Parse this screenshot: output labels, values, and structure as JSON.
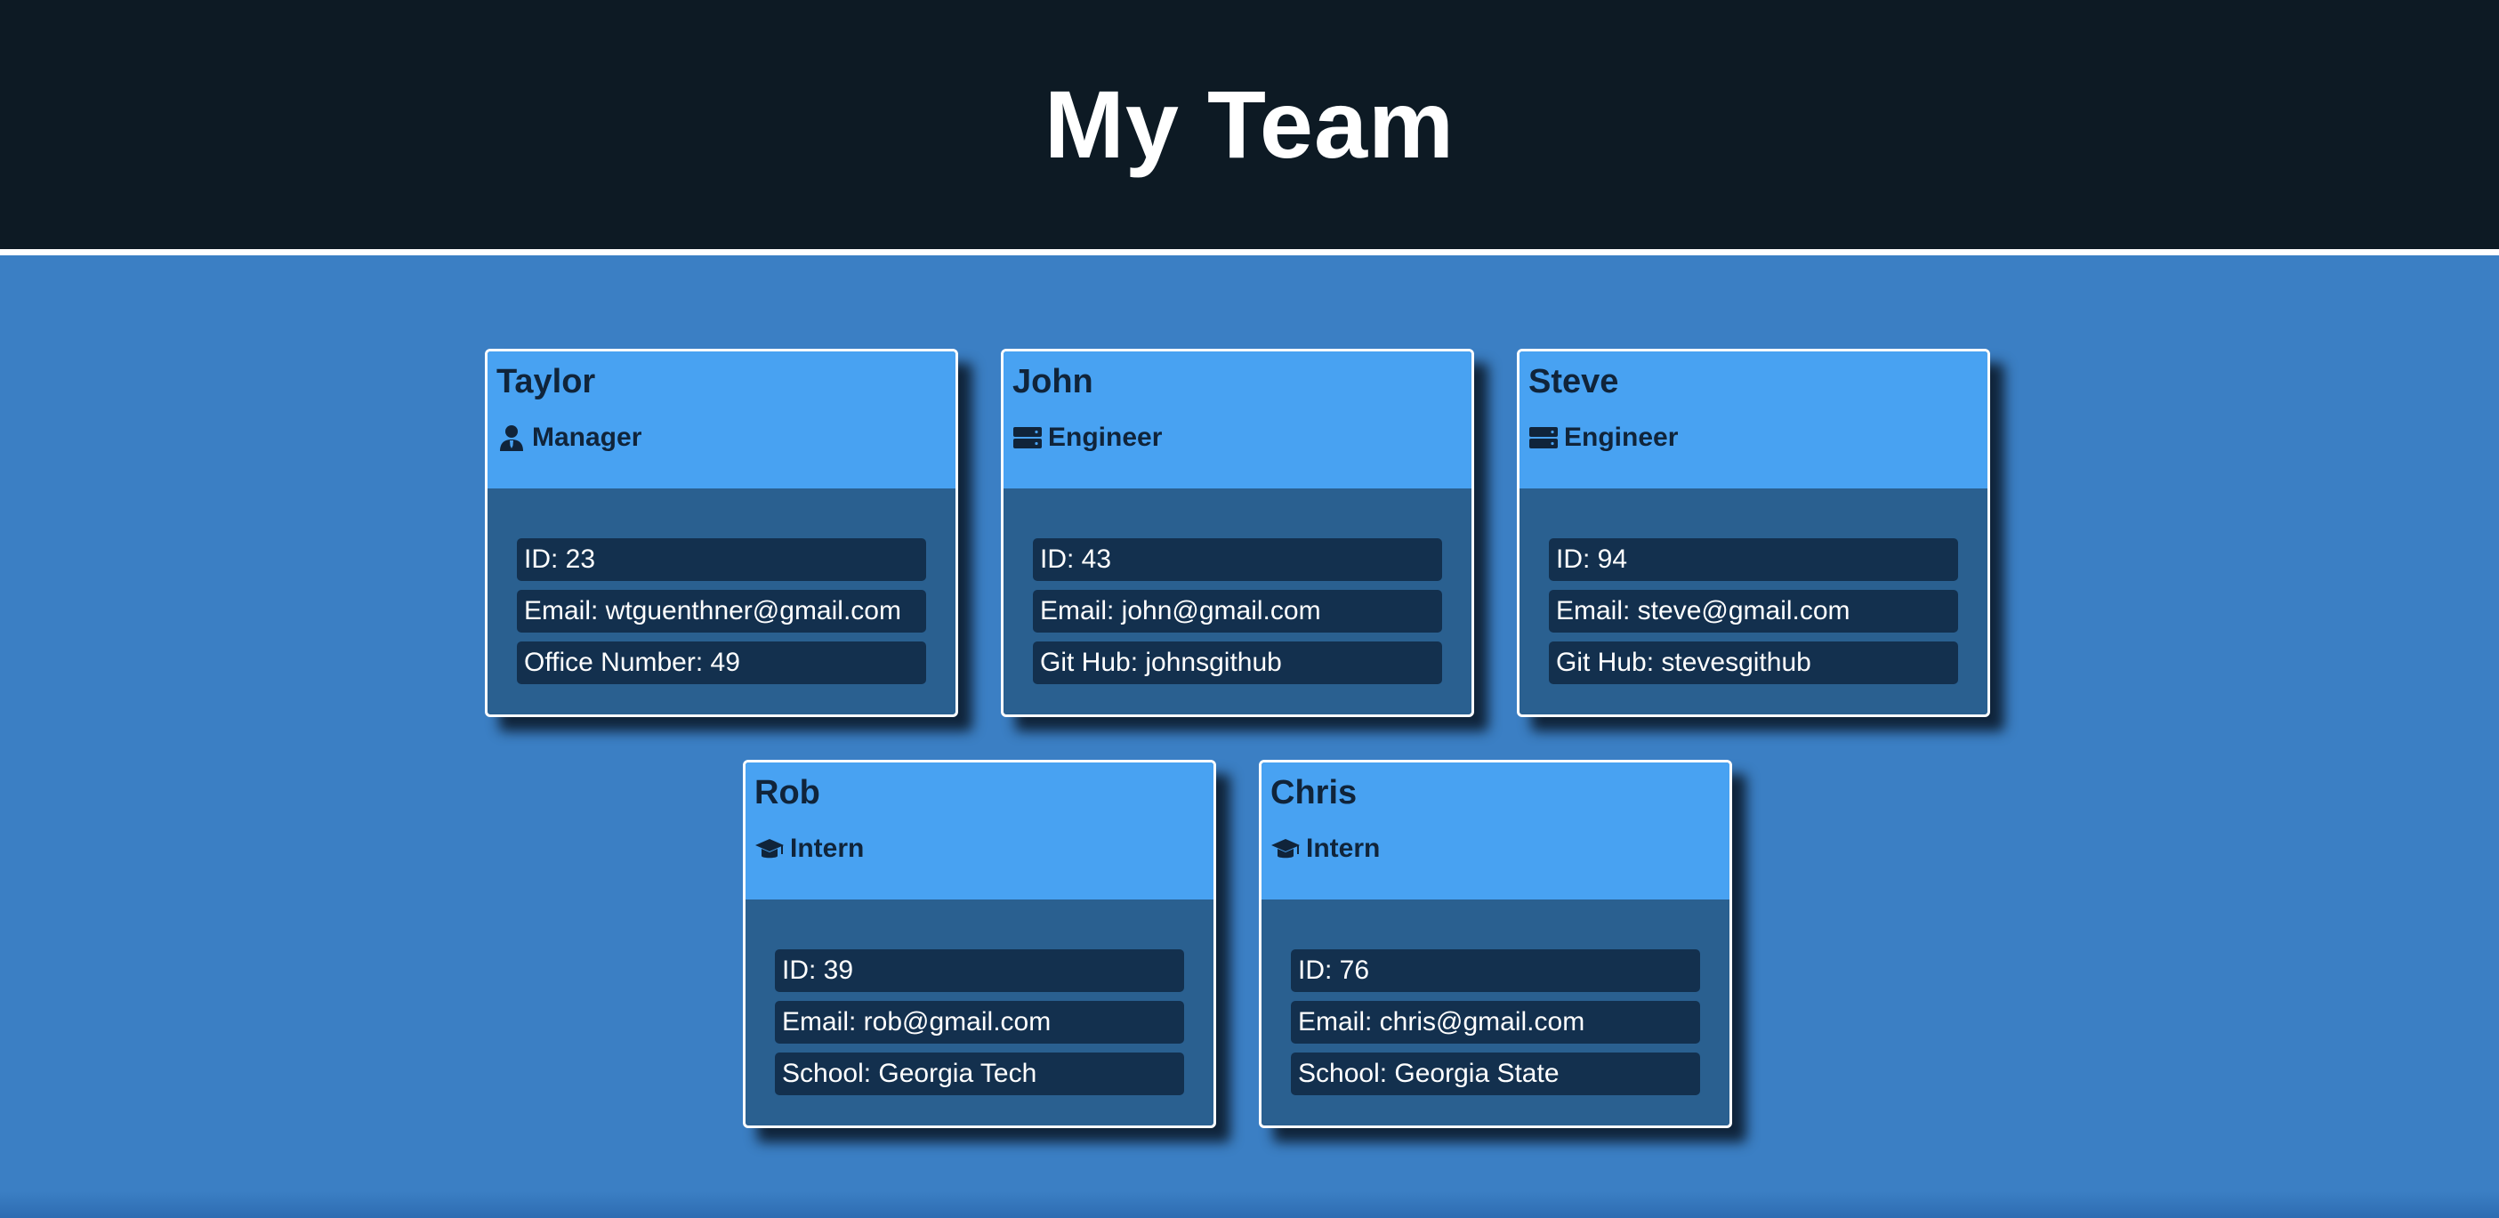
{
  "header": {
    "title": "My Team"
  },
  "team": [
    {
      "name": "Taylor",
      "role": "Manager",
      "role_icon": "user-tie-icon",
      "id_text": "ID: 23",
      "email_text": "Email: wtguenthner@gmail.com",
      "extra_text": "Office Number: 49"
    },
    {
      "name": "John",
      "role": "Engineer",
      "role_icon": "server-icon",
      "id_text": "ID: 43",
      "email_text": "Email: john@gmail.com",
      "extra_text": "Git Hub: johnsgithub"
    },
    {
      "name": "Steve",
      "role": "Engineer",
      "role_icon": "server-icon",
      "id_text": "ID: 94",
      "email_text": "Email: steve@gmail.com",
      "extra_text": "Git Hub: stevesgithub"
    },
    {
      "name": "Rob",
      "role": "Intern",
      "role_icon": "graduation-cap-icon",
      "id_text": "ID: 39",
      "email_text": "Email: rob@gmail.com",
      "extra_text": "School: Georgia Tech"
    },
    {
      "name": "Chris",
      "role": "Intern",
      "role_icon": "graduation-cap-icon",
      "id_text": "ID: 76",
      "email_text": "Email: chris@gmail.com",
      "extra_text": "School: Georgia State"
    }
  ],
  "colors": {
    "header_bg": "#0d1a24",
    "page_bg": "#3b7fc4",
    "card_head_bg": "#48a2f2",
    "card_body_bg": "#2a6090",
    "info_row_bg": "#13304e"
  }
}
